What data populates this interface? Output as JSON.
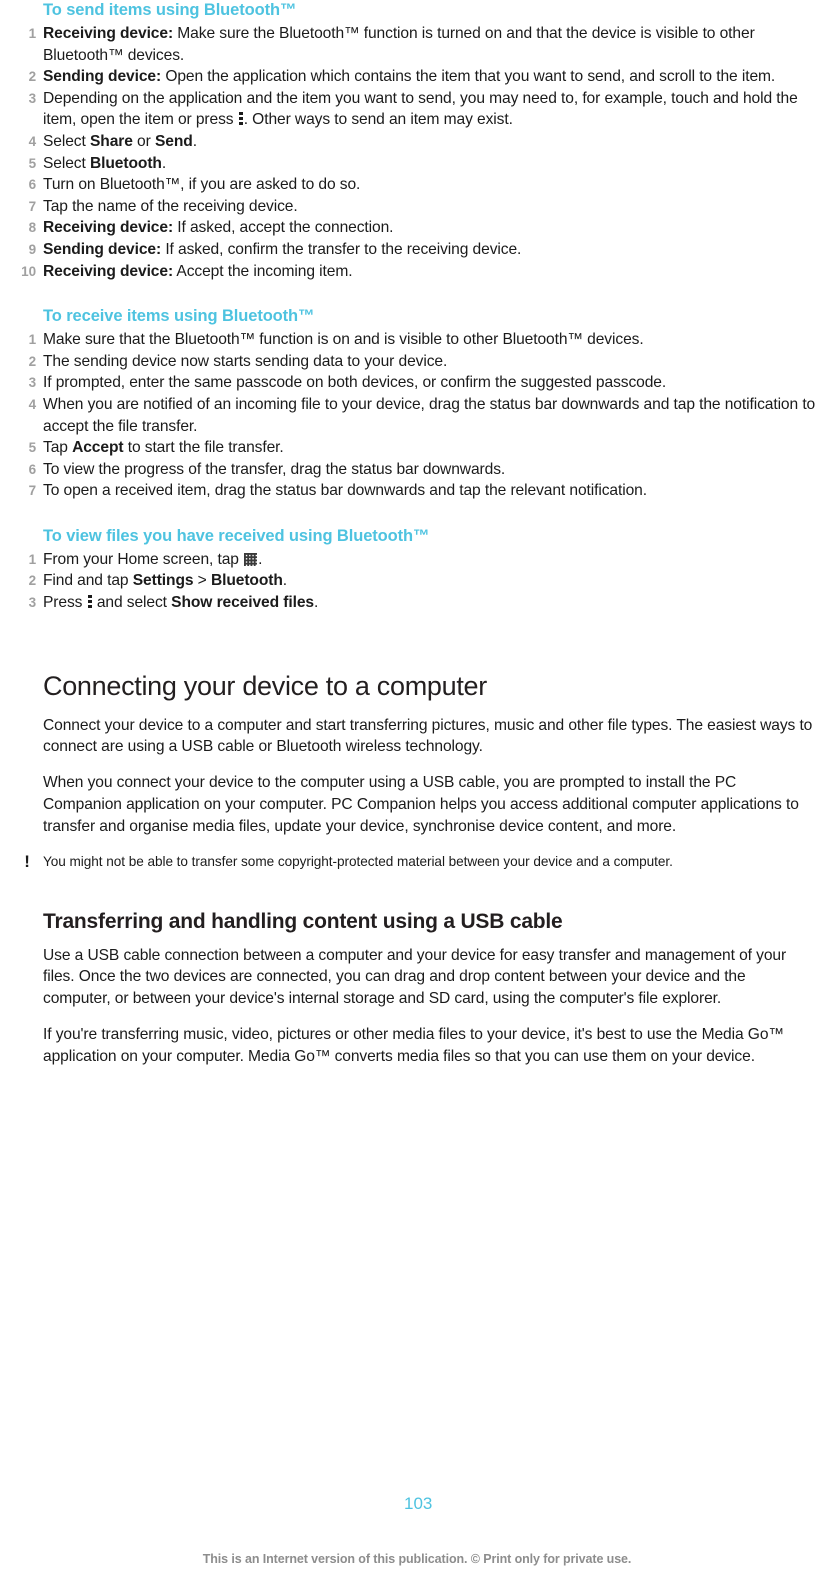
{
  "colors": {
    "accent_heading": "#4ec3e0",
    "page_number": "#4ec3e0",
    "step_number": "#a0a0a0",
    "body_text": "#1b1b1b",
    "footer_text": "#8d8d8d"
  },
  "sections": {
    "send_items": {
      "heading": "To send items using Bluetooth™",
      "steps": [
        {
          "lead": "Receiving device:",
          "text": " Make sure the Bluetooth™ function is turned on and that the device is visible to other Bluetooth™ devices."
        },
        {
          "lead": "Sending device:",
          "text": " Open the application which contains the item that you want to send, and scroll to the item."
        },
        {
          "lead": "",
          "text_before_icon": "Depending on the application and the item you want to send, you may need to, for example, touch and hold the item, open the item or press ",
          "icon": "kebab-menu-icon",
          "text_after_icon": ". Other ways to send an item may exist."
        },
        {
          "lead": "",
          "text_pre": "Select ",
          "bold1": "Share",
          "text_mid": " or ",
          "bold2": "Send",
          "text_post": "."
        },
        {
          "lead": "",
          "text_pre": "Select ",
          "bold1": "Bluetooth",
          "text_post": "."
        },
        {
          "lead": "",
          "text": "Turn on Bluetooth™, if you are asked to do so."
        },
        {
          "lead": "",
          "text": "Tap the name of the receiving device."
        },
        {
          "lead": "Receiving device:",
          "text": " If asked, accept the connection."
        },
        {
          "lead": "Sending device:",
          "text": " If asked, confirm the transfer to the receiving device."
        },
        {
          "lead": "Receiving device:",
          "text": " Accept the incoming item."
        }
      ]
    },
    "receive_items": {
      "heading": "To receive items using Bluetooth™",
      "steps": [
        {
          "text": "Make sure that the Bluetooth™ function is on and is visible to other Bluetooth™ devices."
        },
        {
          "text": "The sending device now starts sending data to your device."
        },
        {
          "text": "If prompted, enter the same passcode on both devices, or confirm the suggested passcode."
        },
        {
          "text": "When you are notified of an incoming file to your device, drag the status bar downwards and tap the notification to accept the file transfer."
        },
        {
          "text_pre": "Tap ",
          "bold1": "Accept",
          "text_post": " to start the file transfer."
        },
        {
          "text": "To view the progress of the transfer, drag the status bar downwards."
        },
        {
          "text": "To open a received item, drag the status bar downwards and tap the relevant notification."
        }
      ]
    },
    "view_files": {
      "heading": "To view files you have received using Bluetooth™",
      "steps": [
        {
          "text_before_icon": "From your Home screen, tap ",
          "icon": "app-grid-icon",
          "text_after_icon": "."
        },
        {
          "text_pre": "Find and tap ",
          "bold1": "Settings",
          "text_mid": " > ",
          "bold2": "Bluetooth",
          "text_post": "."
        },
        {
          "text_before_icon": "Press ",
          "icon": "kebab-menu-icon",
          "text_after_icon_pre": " and select ",
          "bold1": "Show received files",
          "text_after_icon_post": "."
        }
      ]
    },
    "connecting": {
      "heading": "Connecting your device to a computer",
      "paragraphs": [
        "Connect your device to a computer and start transferring pictures, music and other file types. The easiest ways to connect are using a USB cable or Bluetooth wireless technology.",
        "When you connect your device to the computer using a USB cable, you are prompted to install the PC Companion application on your computer. PC Companion helps you access additional computer applications to transfer and organise media files, update your device, synchronise device content, and more."
      ],
      "note": {
        "icon": "exclamation-icon",
        "icon_glyph": "!",
        "text": "You might not be able to transfer some copyright-protected material between your device and a computer."
      }
    },
    "transferring": {
      "heading": "Transferring and handling content using a USB cable",
      "paragraphs": [
        "Use a USB cable connection between a computer and your device for easy transfer and management of your files. Once the two devices are connected, you can drag and drop content between your device and the computer, or between your device's internal storage and SD card, using the computer's file explorer.",
        "If you're transferring music, video, pictures or other media files to your device, it's best to use the Media Go™ application on your computer. Media Go™ converts media files so that you can use them on your device."
      ]
    }
  },
  "footer": {
    "page_number": "103",
    "disclaimer": "This is an Internet version of this publication. © Print only for private use."
  }
}
